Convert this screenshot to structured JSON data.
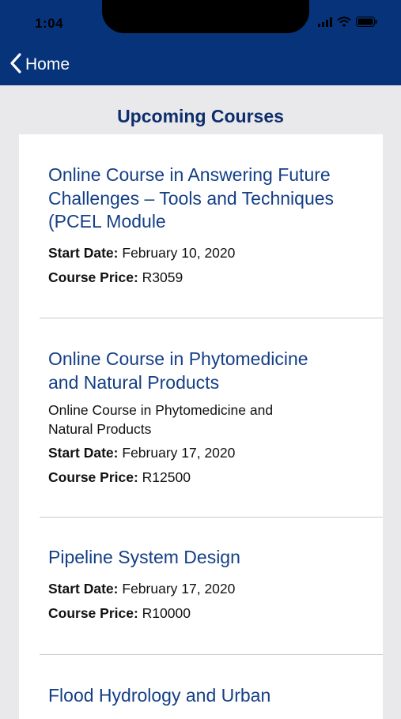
{
  "status_bar": {
    "time": "1:04"
  },
  "nav": {
    "back_label": "Home"
  },
  "page": {
    "title": "Upcoming Courses"
  },
  "courses": [
    {
      "title": "Online Course in Answering Future Challenges – Tools and Techniques (PCEL Module",
      "description": "",
      "start_label": "Start Date:",
      "start_date": "February 10, 2020",
      "price_label": "Course Price:",
      "price": "R3059"
    },
    {
      "title": "Online Course in Phytomedicine and Natural Products",
      "description": "Online Course in Phytomedicine and Natural Products",
      "start_label": "Start Date:",
      "start_date": "February 17, 2020",
      "price_label": "Course Price:",
      "price": "R12500"
    },
    {
      "title": "Pipeline System Design",
      "description": "",
      "start_label": "Start Date:",
      "start_date": "February 17, 2020",
      "price_label": "Course Price:",
      "price": "R10000"
    },
    {
      "title": "Flood Hydrology and Urban"
    }
  ],
  "colors": {
    "header": "#06337a",
    "title": "#0d2d6b",
    "link": "#143f86",
    "background": "#e9e9ec"
  },
  "icons": {
    "back": "chevron-left-icon",
    "wifi": "wifi-icon",
    "battery": "battery-icon",
    "signal": "signal-icon"
  }
}
